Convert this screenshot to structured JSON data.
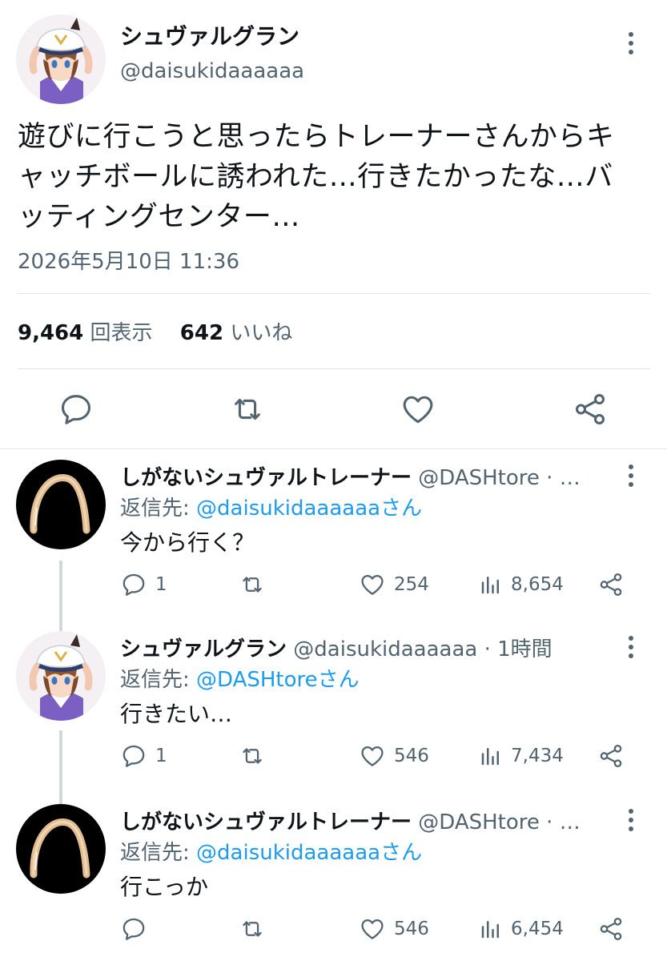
{
  "main_tweet": {
    "display_name": "シュヴァルグラン",
    "handle": "@daisukidaaaaaa",
    "text_lines": [
      "遊びに行こうと思ったらトレーナーさんからキ",
      "ャッチボールに誘われた…行きたかったな…バ",
      "ッティングセンター…"
    ],
    "timestamp": "2026年5月10日 11:36",
    "views_count": "9,464",
    "views_label": "回表示",
    "likes_count": "642",
    "likes_label": "いいね",
    "actions": [
      "comment-icon",
      "retweet-icon",
      "heart-icon",
      "share-icon"
    ]
  },
  "replies": [
    {
      "display_name": "しがないシュヴァルトレーナー",
      "handle_meta": "@DASHtore · …",
      "reply_to_prefix": "返信先: ",
      "reply_to_mention": "@daisukidaaaaaaさん",
      "text": "今から行く？",
      "reply_count": "1",
      "retweet_count": "",
      "like_count": "254",
      "view_count": "8,654",
      "avatar": "headband-avatar"
    },
    {
      "display_name": "シュヴァルグラン",
      "handle_meta": "@daisukidaaaaaa · 1時間",
      "reply_to_prefix": "返信先: ",
      "reply_to_mention": "@DASHtoreさん",
      "text": "行きたい…",
      "reply_count": "1",
      "retweet_count": "",
      "like_count": "546",
      "view_count": "7,434",
      "avatar": "anime-girl-avatar"
    },
    {
      "display_name": "しがないシュヴァルトレーナー",
      "handle_meta": "@DASHtore · …",
      "reply_to_prefix": "返信先: ",
      "reply_to_mention": "@daisukidaaaaaaさん",
      "text": "行こっか",
      "reply_count": "",
      "retweet_count": "",
      "like_count": "546",
      "view_count": "6,454",
      "avatar": "headband-avatar"
    }
  ],
  "colors": {
    "text_primary": "#0f1419",
    "text_secondary": "#536471",
    "link": "#1d9bf0",
    "divider": "#e3e7ea",
    "thread_line": "#cfd9de"
  }
}
